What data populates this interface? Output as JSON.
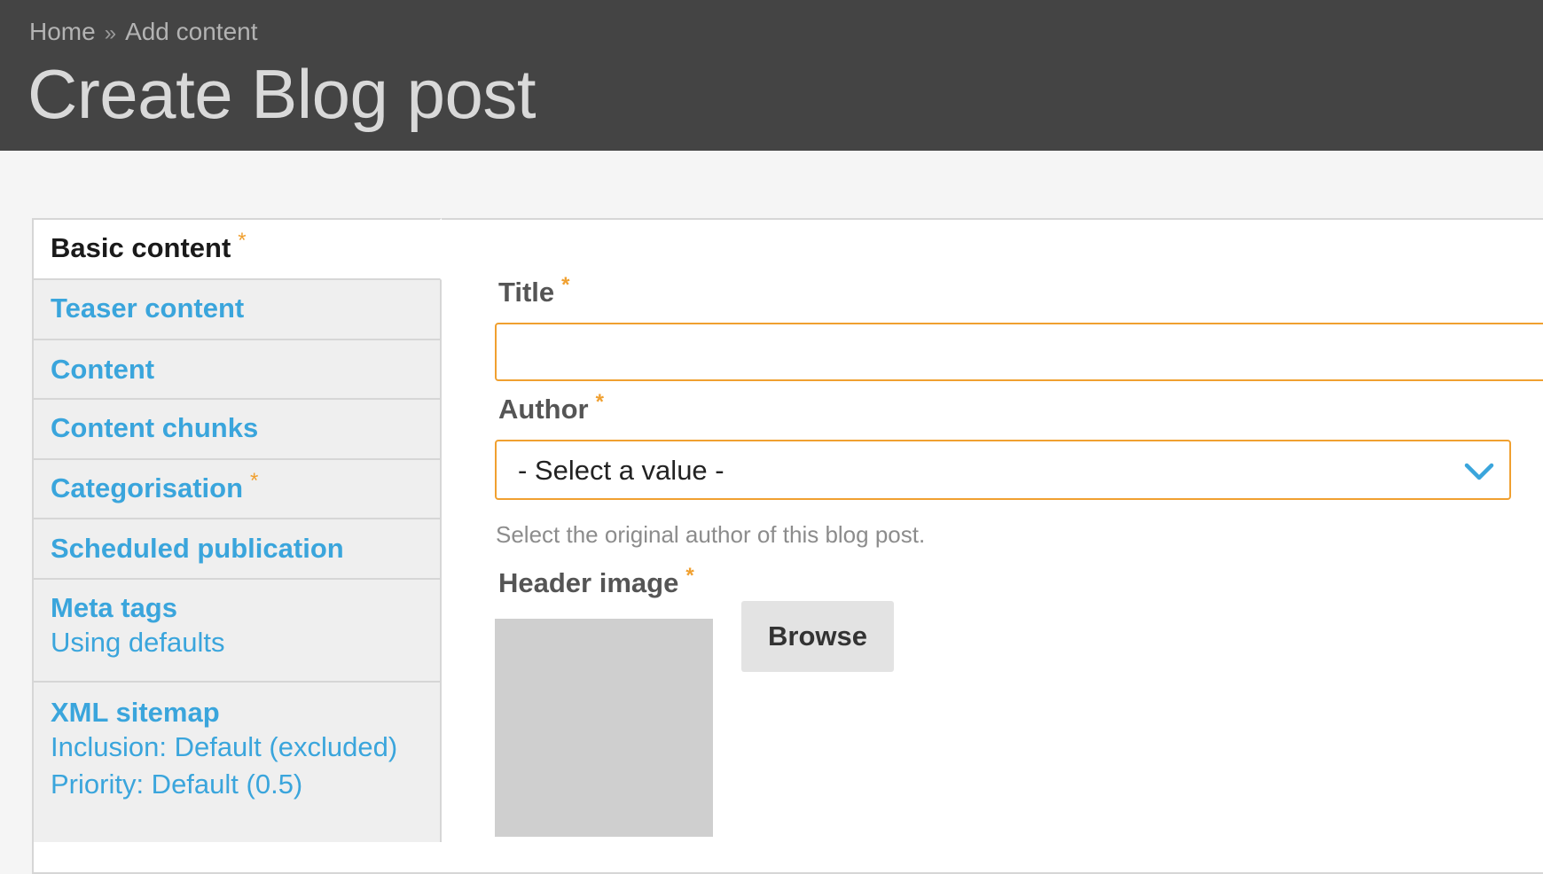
{
  "breadcrumb": {
    "home": "Home",
    "separator": "»",
    "current": "Add content"
  },
  "page_title": "Create Blog post",
  "required_marker": "*",
  "vertical_tabs": [
    {
      "label": "Basic content",
      "required": true,
      "active": true
    },
    {
      "label": "Teaser content"
    },
    {
      "label": "Content"
    },
    {
      "label": "Content chunks"
    },
    {
      "label": "Categorisation",
      "required": true
    },
    {
      "label": "Scheduled publication"
    },
    {
      "label": "Meta tags",
      "summary": [
        "Using defaults"
      ]
    },
    {
      "label": "XML sitemap",
      "summary": [
        "Inclusion: Default (excluded)",
        "Priority: Default (0.5)"
      ]
    }
  ],
  "form": {
    "title_label": "Title",
    "title_value": "",
    "author_label": "Author",
    "author_value": "- Select a value -",
    "author_help": "Select the original author of this blog post.",
    "header_image_label": "Header image",
    "browse_label": "Browse"
  },
  "colors": {
    "header_bg": "#444444",
    "link": "#3aa5dc",
    "required": "#f0a030",
    "focus_border": "#f0a030"
  },
  "icons": {
    "select_arrow": "chevron-down-icon"
  }
}
